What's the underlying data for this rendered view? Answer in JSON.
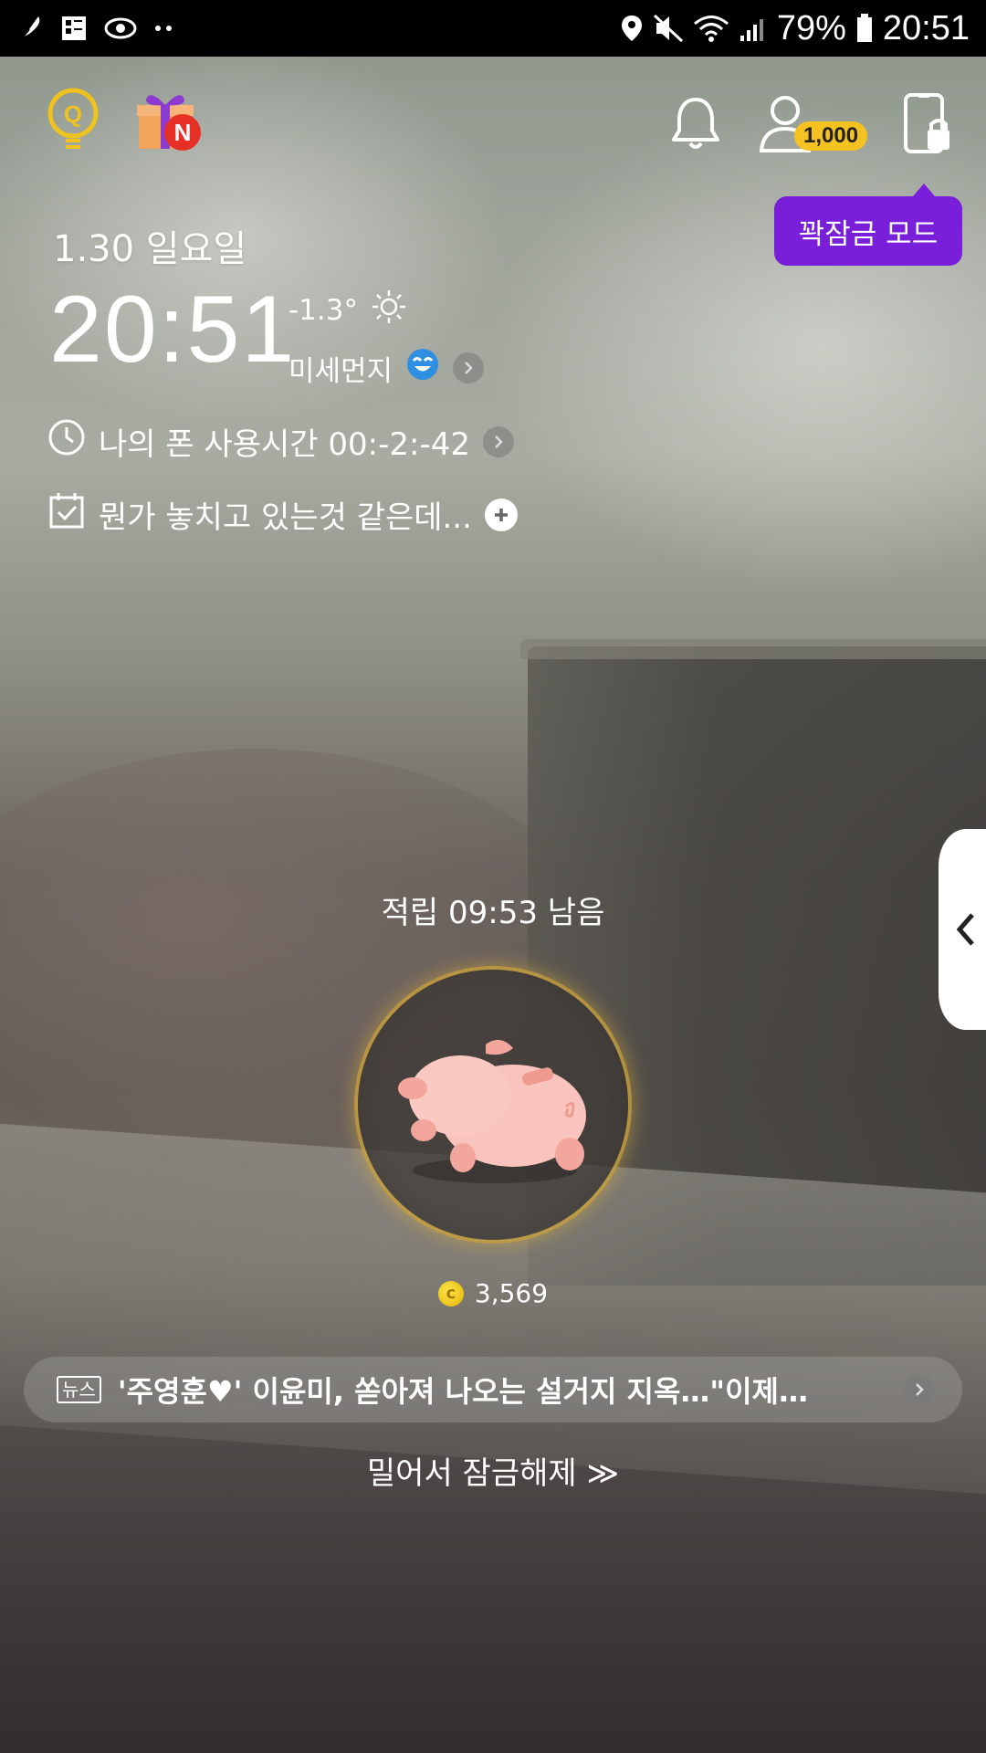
{
  "status_bar": {
    "battery": "79%",
    "time": "20:51",
    "icons_left": [
      "feather-icon",
      "grid-icon",
      "eye-icon",
      "dots-icon"
    ],
    "icons_right": [
      "location-icon",
      "mute-icon",
      "wifi-icon",
      "signal-icon",
      "battery-icon"
    ]
  },
  "topbar": {
    "quiz_icon": "bulb-q-icon",
    "gift_badge": "N",
    "points": "1,000",
    "lock_mode_tooltip": "꽉잠금 모드"
  },
  "clock": {
    "date": "1.30 일요일",
    "time": "20:51",
    "temperature": "-1.3°",
    "weather_icon": "sun-icon",
    "dust_label": "미세먼지",
    "dust_icon": "happy-face-icon"
  },
  "usage": {
    "label": "나의 폰 사용시간 00:-2:-42"
  },
  "todo": {
    "label": "뭔가 놓치고 있는것 같은데..."
  },
  "reward": {
    "label": "적립 09:53 남음",
    "coins": "3,569"
  },
  "news": {
    "tag": "뉴스",
    "headline": "'주영훈♥' 이윤미, 쏟아져 나오는 설거지 지옥…\"이제…"
  },
  "unlock": {
    "label": "밀어서 잠금해제 ≫"
  },
  "colors": {
    "tooltip": "#7a1fd9",
    "points_badge": "#f4c322",
    "gift_badge": "#e63025",
    "quiz_icon": "#f0c21e"
  }
}
